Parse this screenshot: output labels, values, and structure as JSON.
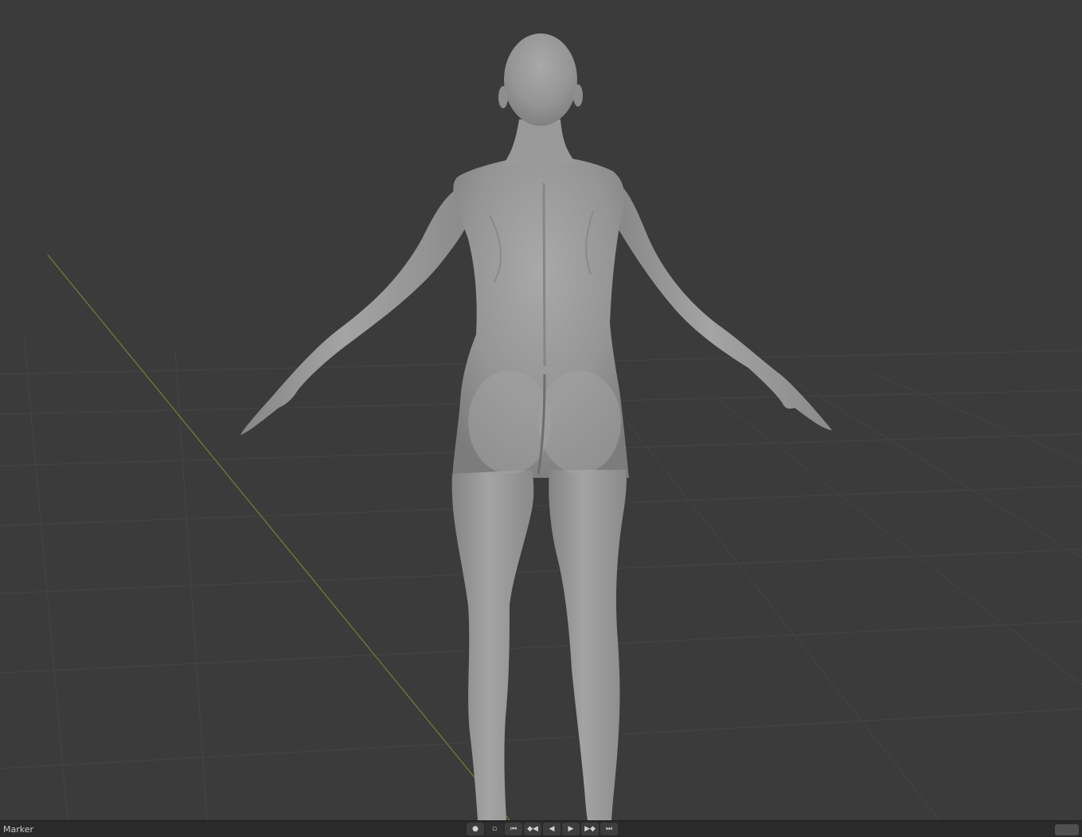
{
  "viewport": {
    "name": "3D Viewport",
    "background": "#3b3b3b",
    "grid_color": "#474747",
    "y_axis_color": "#6b7d3a",
    "model": "human female base mesh, back view"
  },
  "timeline": {
    "menu_label": "Marker",
    "controls": [
      {
        "name": "keyframe-dot-icon",
        "glyph": "●"
      },
      {
        "name": "keyframe-set-icon",
        "glyph": "▫"
      },
      {
        "name": "jump-start-icon",
        "glyph": "⏮"
      },
      {
        "name": "prev-keyframe-icon",
        "glyph": "◆◀"
      },
      {
        "name": "play-reverse-icon",
        "glyph": "◀"
      },
      {
        "name": "play-icon",
        "glyph": "▶"
      },
      {
        "name": "next-keyframe-icon",
        "glyph": "▶◆"
      },
      {
        "name": "jump-end-icon",
        "glyph": "⏭"
      }
    ]
  }
}
